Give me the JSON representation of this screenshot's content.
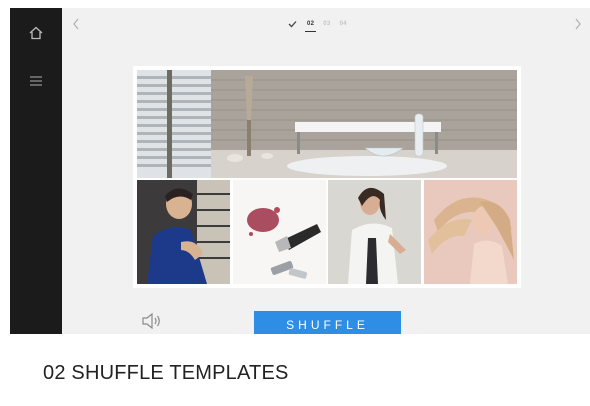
{
  "navigation": {
    "prev_icon": "chevron-left-icon",
    "next_icon": "chevron-right-icon"
  },
  "sidebar": {
    "items": [
      {
        "icon": "home-icon"
      },
      {
        "icon": "hamburger-menu-icon"
      }
    ]
  },
  "steps": {
    "completed_icon": "checkmark-icon",
    "items": [
      {
        "label": "02",
        "state": "active"
      },
      {
        "label": "03",
        "state": "inactive"
      },
      {
        "label": "04",
        "state": "inactive"
      }
    ]
  },
  "preview": {
    "images": [
      "interior-bench-image",
      "man-in-blue-coat-image",
      "makeup-brush-image",
      "woman-in-white-shirt-image",
      "woman-blonde-hair-image"
    ]
  },
  "controls": {
    "sound_icon": "speaker-icon",
    "shuffle_label": "SHUFFLE",
    "shuffle_color": "#2e8ee6"
  },
  "caption": "02 SHUFFLE TEMPLATES",
  "colors": {
    "sidebar": "#1b1b1b",
    "canvas": "#f1f1f1",
    "accent": "#2e8ee6"
  }
}
